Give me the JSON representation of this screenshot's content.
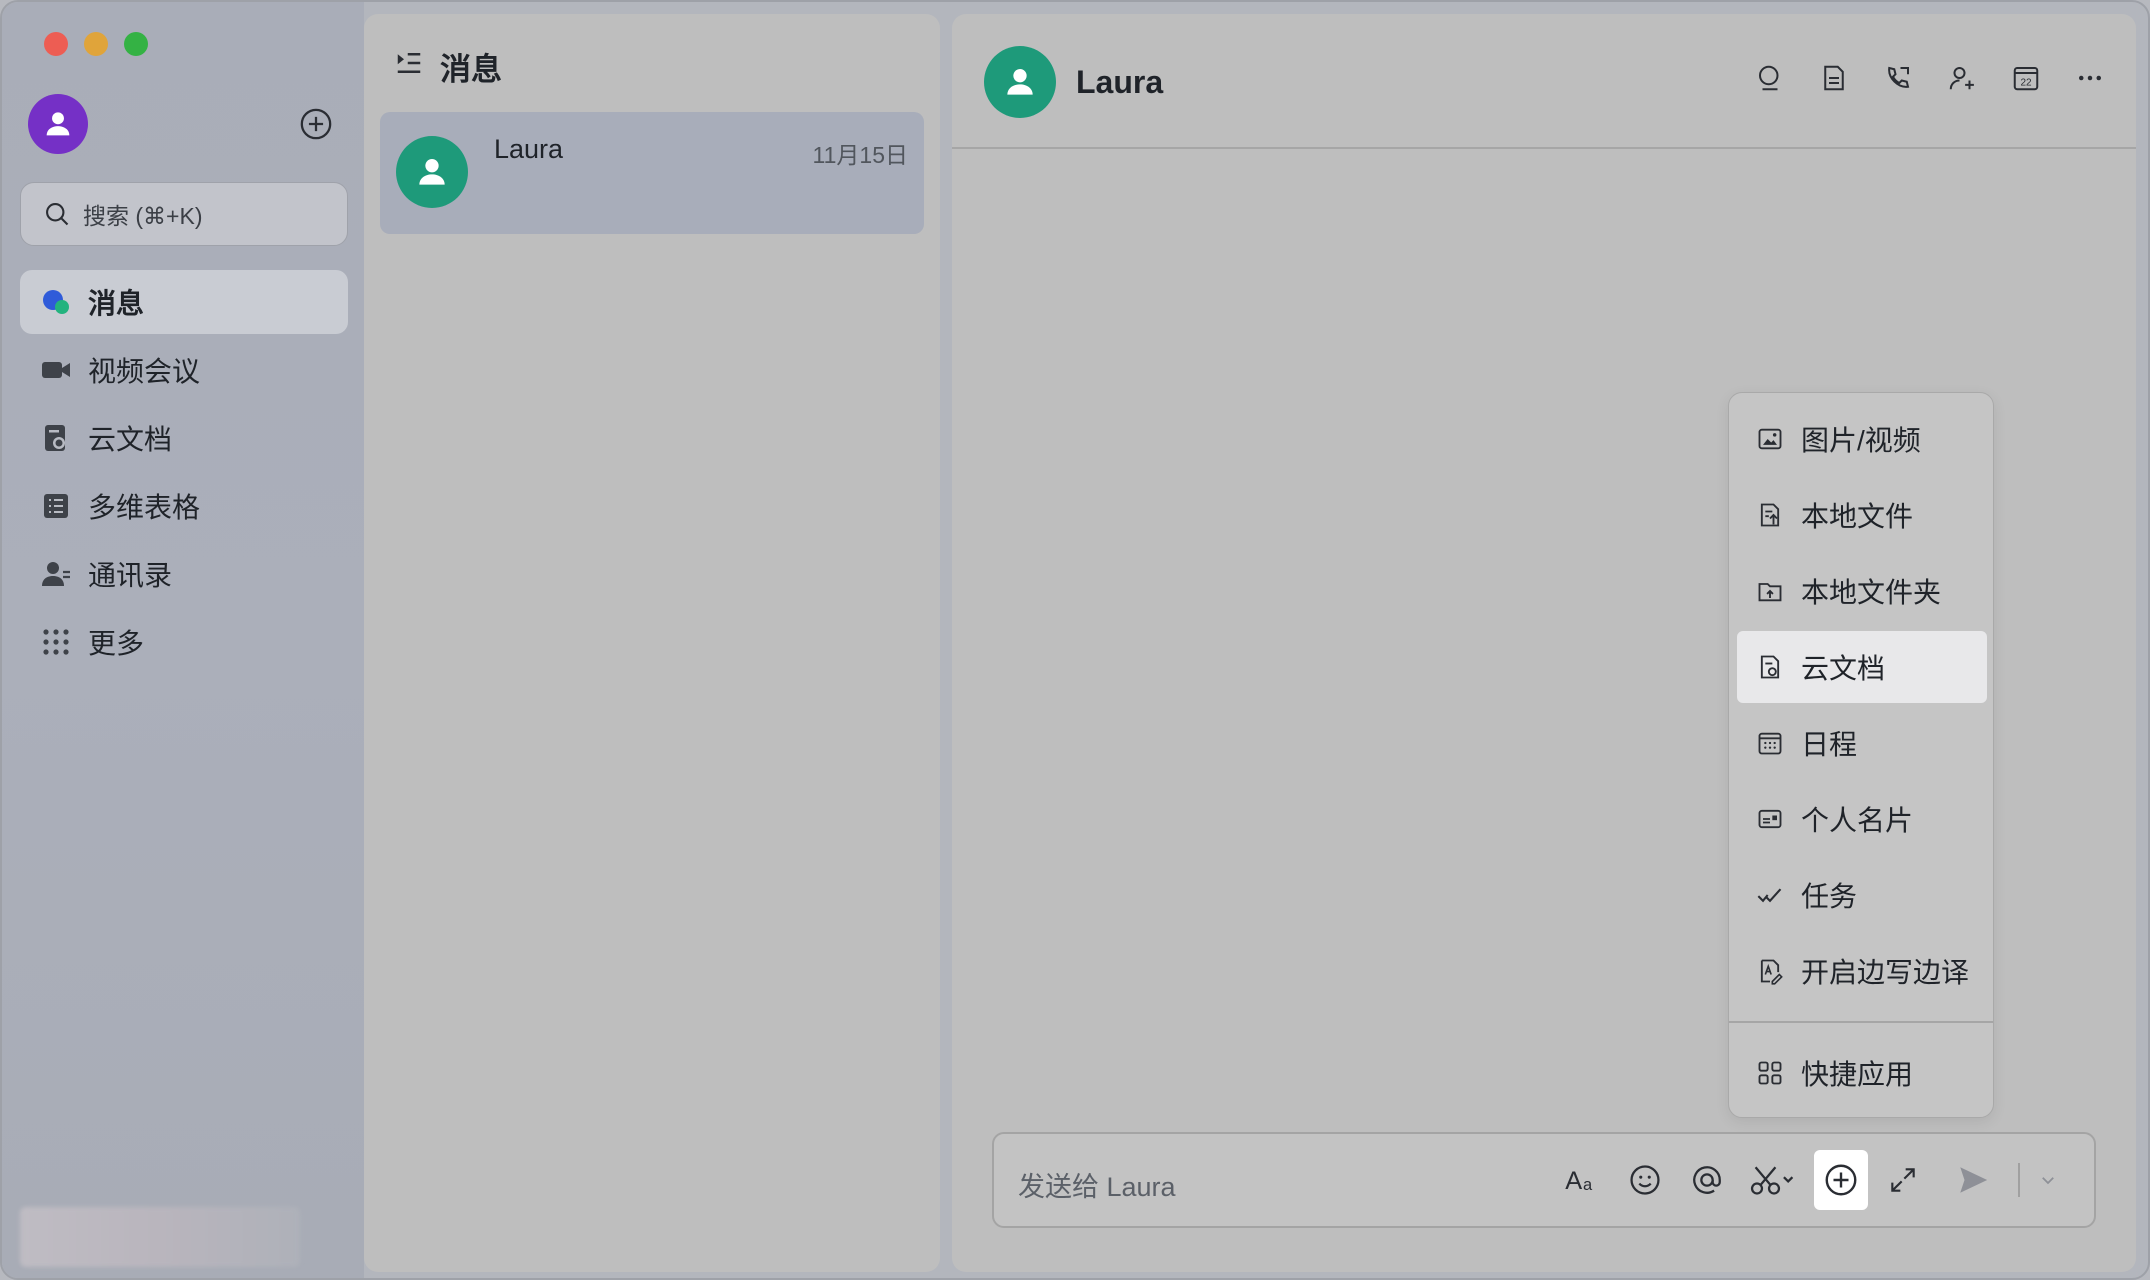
{
  "window": {
    "traffic_lights": {
      "close": "#ed5d53",
      "minimize": "#e0a43a",
      "maximize": "#34b244"
    }
  },
  "sidebar": {
    "search_placeholder": "搜索 (⌘+K)",
    "items": [
      {
        "label": "消息",
        "icon": "message-bubble-icon",
        "active": true
      },
      {
        "label": "视频会议",
        "icon": "video-camera-icon",
        "active": false
      },
      {
        "label": "云文档",
        "icon": "cloud-doc-icon",
        "active": false
      },
      {
        "label": "多维表格",
        "icon": "base-table-icon",
        "active": false
      },
      {
        "label": "通讯录",
        "icon": "contacts-icon",
        "active": false
      },
      {
        "label": "更多",
        "icon": "more-dots-grid-icon",
        "active": false
      }
    ]
  },
  "chatlist": {
    "title": "消息",
    "chats": [
      {
        "name": "Laura",
        "date": "11月15日",
        "avatar_color": "#1e9a7a"
      }
    ]
  },
  "conversation": {
    "title": "Laura",
    "header_tools": [
      "search-icon",
      "doc-icon",
      "phone-call-icon",
      "add-member-icon",
      "calendar-icon",
      "more-icon"
    ],
    "input_placeholder": "发送给 Laura",
    "input_tools": [
      "text-format-icon",
      "emoji-icon",
      "mention-icon",
      "screenshot-scissors-icon",
      "plus-circle-icon",
      "expand-icon",
      "send-icon",
      "send-options-chevron-icon"
    ]
  },
  "attach_menu": {
    "items": [
      {
        "label": "图片/视频",
        "icon": "image-icon"
      },
      {
        "label": "本地文件",
        "icon": "local-file-icon"
      },
      {
        "label": "本地文件夹",
        "icon": "folder-icon"
      },
      {
        "label": "云文档",
        "icon": "cloud-doc-icon",
        "highlighted": true
      },
      {
        "label": "日程",
        "icon": "calendar-icon"
      },
      {
        "label": "个人名片",
        "icon": "contact-card-icon"
      },
      {
        "label": "任务",
        "icon": "task-check-icon"
      },
      {
        "label": "开启边写边译",
        "icon": "translate-icon"
      }
    ],
    "footer_item": {
      "label": "快捷应用",
      "icon": "quick-apps-icon"
    }
  }
}
